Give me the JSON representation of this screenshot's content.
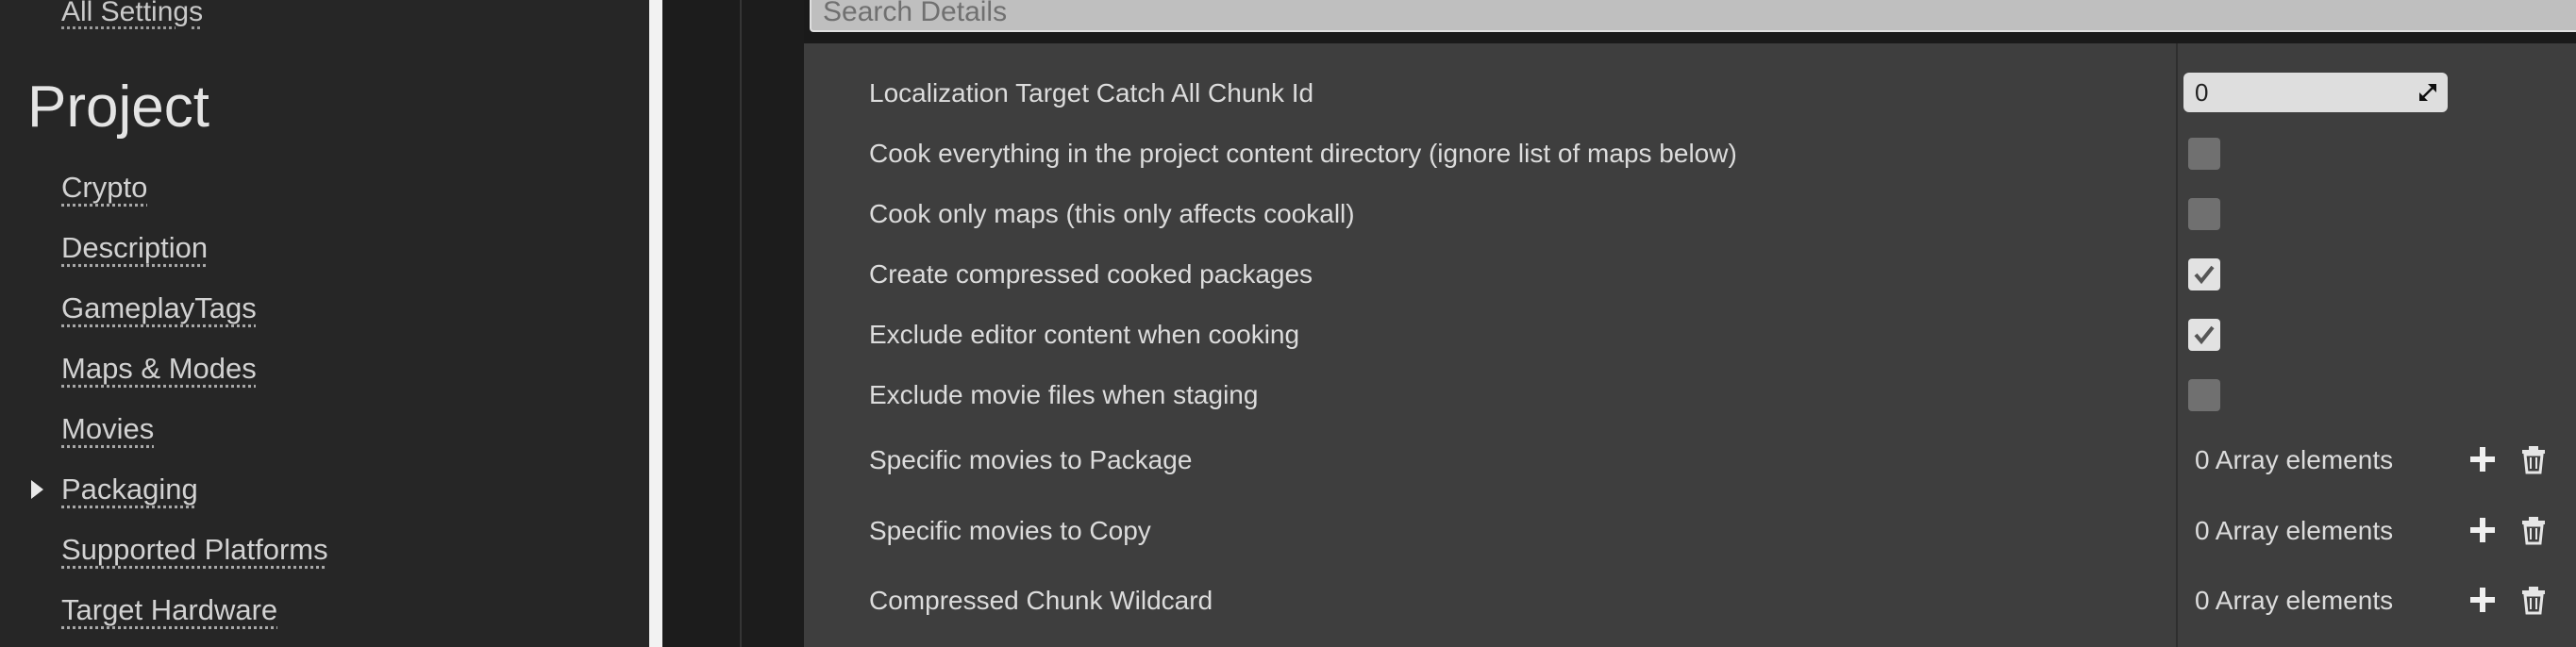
{
  "sidebar": {
    "all_settings": "All Settings",
    "section_title": "Project",
    "items": [
      {
        "label": "Crypto"
      },
      {
        "label": "Description"
      },
      {
        "label": "GameplayTags"
      },
      {
        "label": "Maps & Modes"
      },
      {
        "label": "Movies"
      },
      {
        "label": "Packaging",
        "selected": true
      },
      {
        "label": "Supported Platforms"
      },
      {
        "label": "Target Hardware"
      }
    ]
  },
  "search": {
    "placeholder": "Search Details"
  },
  "details": {
    "rows": [
      {
        "label": "Localization Target Catch All Chunk Id",
        "type": "number",
        "value": "0"
      },
      {
        "label": "Cook everything in the project content directory (ignore list of maps below)",
        "type": "checkbox",
        "checked": false
      },
      {
        "label": "Cook only maps (this only affects cookall)",
        "type": "checkbox",
        "checked": false
      },
      {
        "label": "Create compressed cooked packages",
        "type": "checkbox",
        "checked": true
      },
      {
        "label": "Exclude editor content when cooking",
        "type": "checkbox",
        "checked": true
      },
      {
        "label": "Exclude movie files when staging",
        "type": "checkbox",
        "checked": false
      },
      {
        "label": "Specific movies to Package",
        "type": "array",
        "value": "0 Array elements"
      },
      {
        "label": "Specific movies to Copy",
        "type": "array",
        "value": "0 Array elements"
      },
      {
        "label": "Compressed Chunk Wildcard",
        "type": "array",
        "value": "0 Array elements"
      }
    ]
  },
  "icons": {
    "expand": "triangle-right-icon",
    "spin": "spin-arrows-icon",
    "check": "checkmark-icon",
    "add": "plus-icon",
    "delete": "trash-icon"
  },
  "colors": {
    "sidebar_bg": "#262626",
    "panel_bg": "#3e3e3e",
    "text": "#dcdcdc",
    "checkbox_off": "#707070",
    "checkbox_on": "#e2e2e2"
  }
}
